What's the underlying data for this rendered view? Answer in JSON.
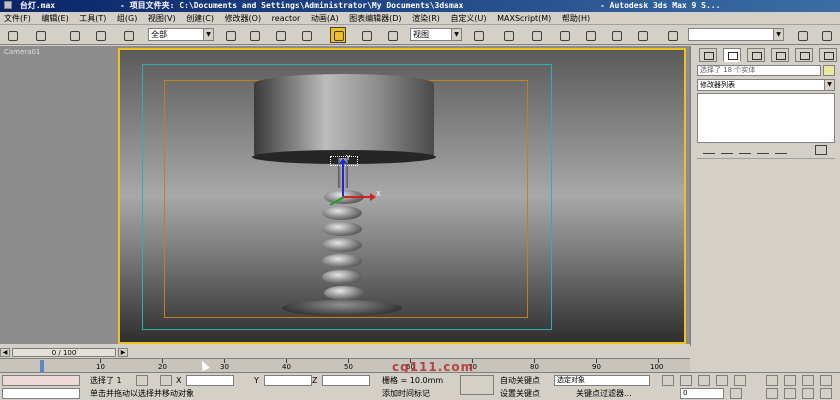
{
  "titlebar": {
    "file": "台灯.max",
    "project": "- 项目文件夹: C:\\Documents and Settings\\Administrator\\My Documents\\3dsmax",
    "app": "- Autodesk 3ds Max 9 S..."
  },
  "menu": [
    "文件(F)",
    "编辑(E)",
    "工具(T)",
    "组(G)",
    "视图(V)",
    "创建(C)",
    "修改器(O)",
    "reactor",
    "动画(A)",
    "图表编辑器(D)",
    "渲染(R)",
    "自定义(U)",
    "MAXScript(M)",
    "帮助(H)"
  ],
  "toolbar": {
    "selection_filter": "全部",
    "ref_coord": "视图"
  },
  "viewport": {
    "label": "Camera01",
    "gizmo_x": "X",
    "gizmo_y": "Y"
  },
  "command_panel": {
    "selection": "选择了 18 个实体",
    "modifier_list": "修改器列表",
    "swatch_color": "#e8e8a0"
  },
  "timeline": {
    "frame": "0 / 100",
    "ticks": [
      "10",
      "20",
      "30",
      "40",
      "50",
      "60",
      "70",
      "80",
      "90",
      "100"
    ]
  },
  "status": {
    "selected": "选择了 1",
    "x_label": "X",
    "y_label": "Y",
    "z_label": "Z",
    "grid": "栅格 = 10.0mm",
    "auto_key": "自动关键点",
    "selected_obj": "选定对象",
    "set_key": "设置关键点",
    "key_filter": "关键点过滤器...",
    "prompt": "单击并拖动以选择并移动对象",
    "add_time_tag": "添加时间标记",
    "frame_value": "0",
    "watermark": "cg111.com"
  }
}
